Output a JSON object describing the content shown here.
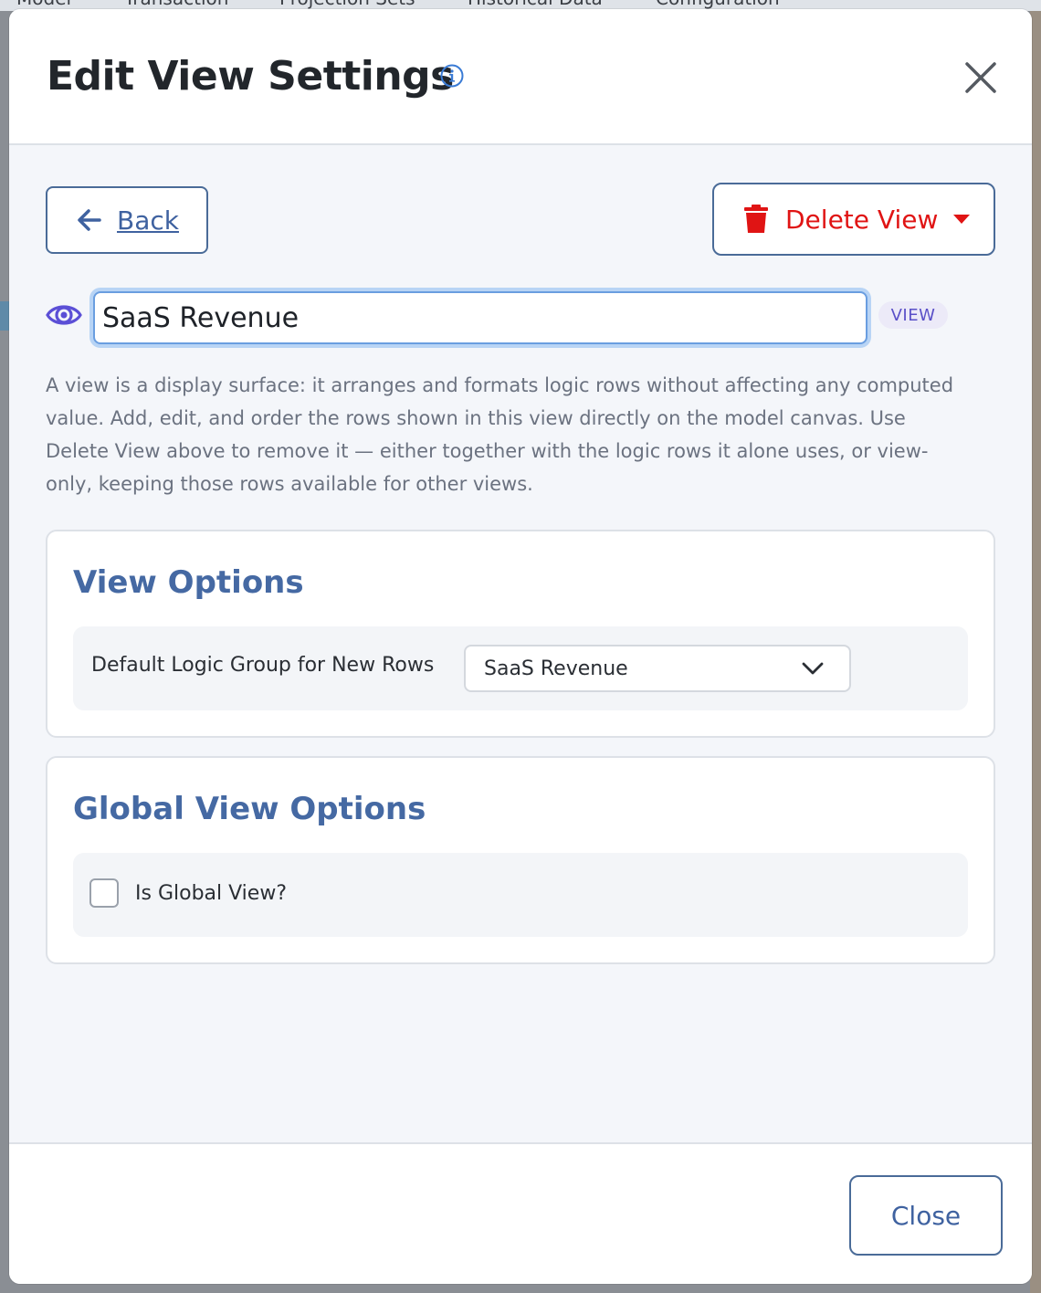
{
  "background_tabs": [
    "Model",
    "Transaction",
    "Projection Sets",
    "Historical Data",
    "Configuration"
  ],
  "modal": {
    "title": "Edit View Settings",
    "info_icon": "info-circle-icon",
    "close_icon": "close-x-icon"
  },
  "toolbar": {
    "back_label": "Back",
    "back_icon": "arrow-left-icon",
    "delete_label": "Delete View",
    "delete_icon": "trash-icon",
    "delete_caret_icon": "caret-down-icon",
    "delete_color": "#e01414"
  },
  "view_name": {
    "icon": "eye-icon",
    "value": "SaaS Revenue",
    "badge": "VIEW"
  },
  "description": "A view is a display surface: it arranges and formats logic rows without affecting any computed value. Add, edit, and order the rows shown in this view directly on the model canvas. Use Delete View above to remove it — either together with the logic rows it alone uses, or view-only, keeping those rows available for other views.",
  "view_options": {
    "title": "View Options",
    "default_group_label": "Default Logic Group for New Rows",
    "default_group_value": "SaaS Revenue",
    "dropdown_icon": "chevron-down-icon"
  },
  "global_options": {
    "title": "Global View Options",
    "is_global_label": "Is Global View?",
    "is_global_checked": false
  },
  "footer": {
    "close_label": "Close"
  },
  "colors": {
    "accent": "#4569a3",
    "button_border": "#4a6b98",
    "badge_text": "#5a50c8"
  }
}
